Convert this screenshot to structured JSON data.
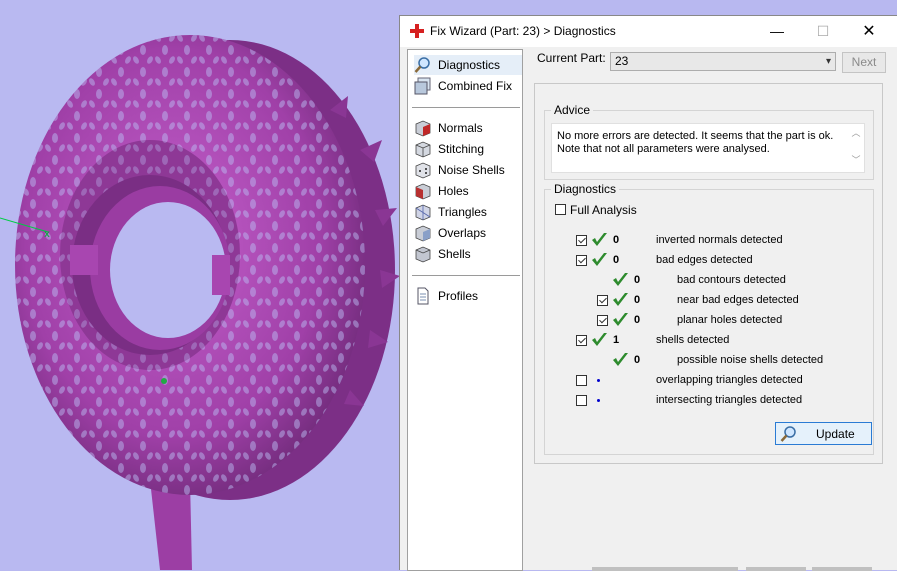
{
  "window": {
    "title": "Fix Wizard (Part: 23) > Diagnostics",
    "min_glyph": "—",
    "max_glyph": "☐",
    "close_glyph": "✕"
  },
  "nav": {
    "items": [
      {
        "label": "Diagnostics",
        "icon": "magnifier-icon",
        "selected": true
      },
      {
        "label": "Combined Fix",
        "icon": "combined-fix-icon"
      },
      {
        "label": "Normals",
        "icon": "normals-cube-icon"
      },
      {
        "label": "Stitching",
        "icon": "stitching-cube-icon"
      },
      {
        "label": "Noise Shells",
        "icon": "noise-shells-dice-icon"
      },
      {
        "label": "Holes",
        "icon": "holes-cube-icon"
      },
      {
        "label": "Triangles",
        "icon": "triangles-cube-icon"
      },
      {
        "label": "Overlaps",
        "icon": "overlaps-cube-icon"
      },
      {
        "label": "Shells",
        "icon": "shells-cube-icon"
      },
      {
        "label": "Profiles",
        "icon": "profile-document-icon"
      }
    ]
  },
  "current_part": {
    "label": "Current Part:",
    "value": "23",
    "next_label": "Next"
  },
  "advice": {
    "label": "Advice",
    "line1": "No more errors are detected. It seems that the part is ok.",
    "line2": "Note that not all parameters were analysed."
  },
  "diagnostics": {
    "label": "Diagnostics",
    "full_analysis_label": "Full Analysis",
    "rows": [
      {
        "checkbox": true,
        "checked": true,
        "status": "ok",
        "count": "0",
        "label": "inverted normals detected",
        "indent": 0
      },
      {
        "checkbox": true,
        "checked": true,
        "status": "ok",
        "count": "0",
        "label": "bad edges detected",
        "indent": 0
      },
      {
        "checkbox": false,
        "checked": false,
        "status": "ok",
        "count": "0",
        "label": "bad contours detected",
        "indent": 1
      },
      {
        "checkbox": true,
        "checked": true,
        "status": "ok",
        "count": "0",
        "label": "near bad edges detected",
        "indent": 1
      },
      {
        "checkbox": true,
        "checked": true,
        "status": "ok",
        "count": "0",
        "label": "planar holes detected",
        "indent": 1
      },
      {
        "checkbox": true,
        "checked": true,
        "status": "ok",
        "count": "1",
        "label": "shells detected",
        "indent": 0
      },
      {
        "checkbox": false,
        "checked": false,
        "status": "ok",
        "count": "0",
        "label": "possible noise shells detected",
        "indent": 1
      },
      {
        "checkbox": true,
        "checked": false,
        "status": "pending",
        "count": "",
        "label": "overlapping triangles detected",
        "indent": 0
      },
      {
        "checkbox": true,
        "checked": false,
        "status": "pending",
        "count": "",
        "label": "intersecting triangles detected",
        "indent": 0
      }
    ],
    "update_label": "Update"
  },
  "colors": {
    "viewport_bg": "#b9b9f1",
    "model_purple": "#a040a8",
    "check_green": "#2e8b2e",
    "accent_blue": "#2a7bd4"
  }
}
